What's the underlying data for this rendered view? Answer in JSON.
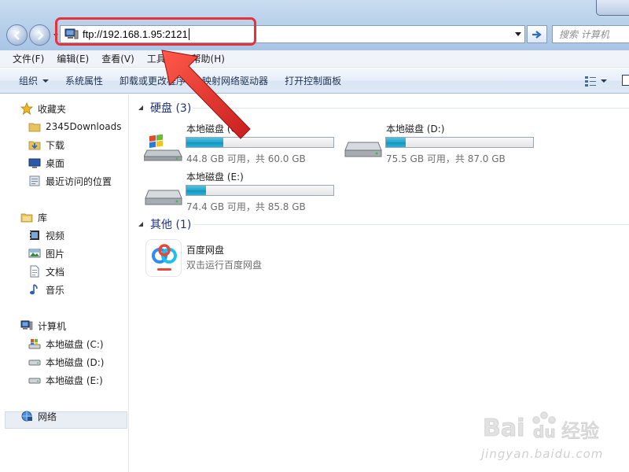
{
  "address_bar": {
    "url": "ftp://192.168.1.95:2121",
    "search_placeholder": "搜索 计算机"
  },
  "menu": [
    "文件(F)",
    "编辑(E)",
    "查看(V)",
    "工具(T)",
    "帮助(H)"
  ],
  "commands": [
    "组织",
    "系统属性",
    "卸载或更改程序",
    "映射网络驱动器",
    "打开控制面板"
  ],
  "nav_pane": {
    "favorites": {
      "label": "收藏夹",
      "items": [
        "2345Downloads",
        "下载",
        "桌面",
        "最近访问的位置"
      ]
    },
    "libraries": {
      "label": "库",
      "items": [
        "视频",
        "图片",
        "文档",
        "音乐"
      ]
    },
    "computer": {
      "label": "计算机",
      "items": [
        "本地磁盘 (C:)",
        "本地磁盘 (D:)",
        "本地磁盘 (E:)"
      ]
    },
    "network": {
      "label": "网络"
    }
  },
  "groups": {
    "hard_disks": {
      "title": "硬盘 (3)",
      "drives": [
        {
          "name": "本地磁盘 (C:)",
          "size_text": "44.8 GB 可用，共 60.0 GB",
          "used_fraction": 0.253
        },
        {
          "name": "本地磁盘 (D:)",
          "size_text": "75.5 GB 可用，共 87.0 GB",
          "used_fraction": 0.132
        },
        {
          "name": "本地磁盘 (E:)",
          "size_text": "74.4 GB 可用，共 85.8 GB",
          "used_fraction": 0.133
        }
      ]
    },
    "other": {
      "title": "其他 (1)",
      "app": {
        "name": "百度网盘",
        "desc": "双击运行百度网盘"
      }
    }
  },
  "watermark": {
    "text": "jingyan.baidu.com"
  },
  "colors": {
    "highlight": "#e8323a",
    "group_title": "#1e3287",
    "drive_fill": "#23a5cc"
  }
}
